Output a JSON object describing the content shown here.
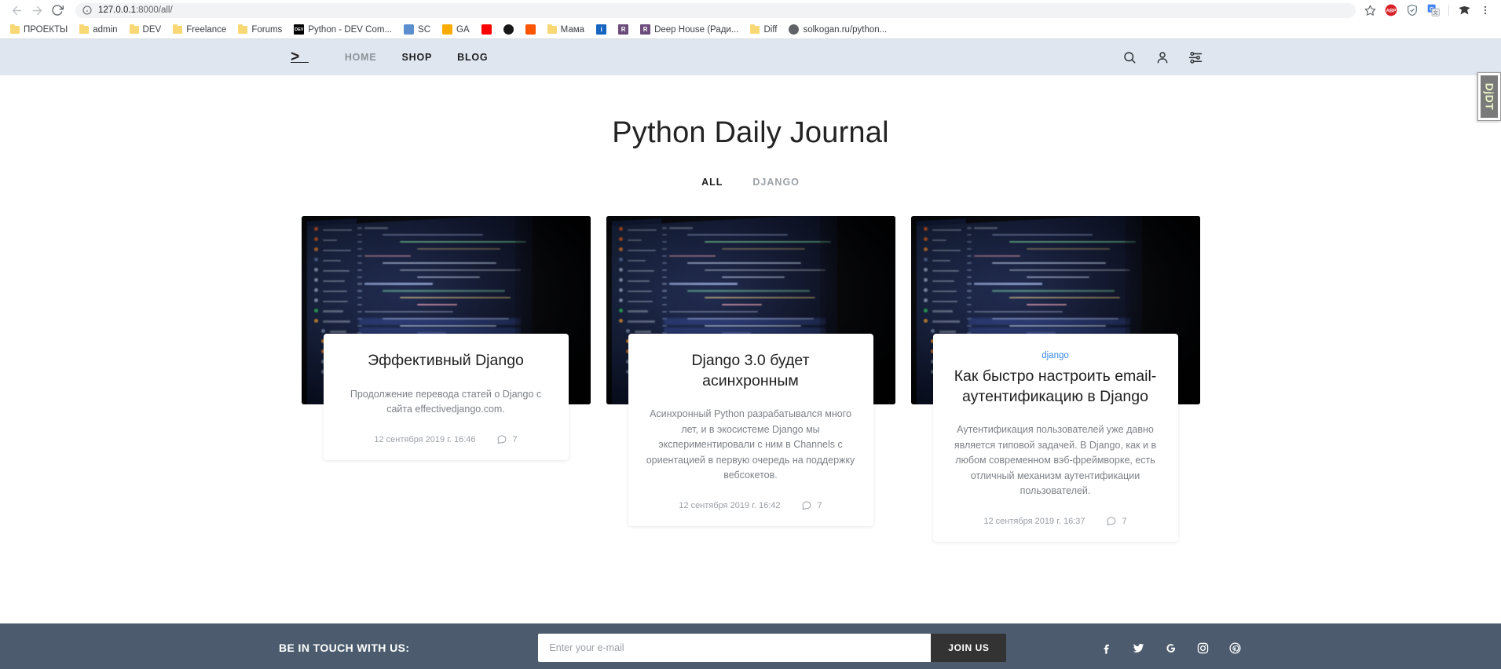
{
  "browser": {
    "back_label": "Back",
    "forward_label": "Forward",
    "reload_label": "Reload",
    "url_host": "127.0.0.1",
    "url_rest": ":8000/all/",
    "site_info_icon": "info-circle-icon",
    "bookmark_star_icon": "star-icon",
    "extensions": [
      {
        "name": "adblock-plus-extension",
        "label": "ABP",
        "color": "#d81f26"
      },
      {
        "name": "shield-extension",
        "label": "",
        "color": "#6b7b86"
      },
      {
        "name": "google-translate-extension",
        "label": "G",
        "color": "#4285f4"
      },
      {
        "name": "dark-reader-extension",
        "label": "",
        "color": "#3a3a3a"
      }
    ],
    "menu_icon": "three-dots-menu-icon",
    "bookmarks": [
      {
        "label": "ПРОЕКТЫ",
        "icon": "folder-icon",
        "type": "folder"
      },
      {
        "label": "admin",
        "icon": "folder-icon",
        "type": "folder"
      },
      {
        "label": "DEV",
        "icon": "folder-icon",
        "type": "folder"
      },
      {
        "label": "Freelance",
        "icon": "folder-icon",
        "type": "folder"
      },
      {
        "label": "Forums",
        "icon": "folder-icon",
        "type": "folder"
      },
      {
        "label": "Python - DEV Com...",
        "icon": "dev-to-favicon",
        "type": "site",
        "color": "#000000",
        "glyph": "DEV"
      },
      {
        "label": "SC",
        "icon": "scholar-favicon",
        "type": "site",
        "color": "#5b8fd0",
        "glyph": ""
      },
      {
        "label": "GA",
        "icon": "google-analytics-favicon",
        "type": "site",
        "color": "#f9ab00",
        "glyph": ""
      },
      {
        "label": "",
        "icon": "youtube-favicon",
        "type": "site",
        "color": "#ff0000",
        "glyph": ""
      },
      {
        "label": "",
        "icon": "github-favicon",
        "type": "site",
        "color": "#181717",
        "glyph": ""
      },
      {
        "label": "",
        "icon": "soundcloud-favicon",
        "type": "site",
        "color": "#ff5500",
        "glyph": ""
      },
      {
        "label": "Мама",
        "icon": "folder-icon",
        "type": "folder"
      },
      {
        "label": "",
        "icon": "info-favicon",
        "type": "site",
        "color": "#1565c0",
        "glyph": "i"
      },
      {
        "label": "",
        "icon": "radio-record-favicon",
        "type": "site",
        "color": "#6b4c7a",
        "glyph": "R"
      },
      {
        "label": "Deep House (Ради...",
        "icon": "radio-favicon",
        "type": "site",
        "color": "#6b4c7a",
        "glyph": "R"
      },
      {
        "label": "Diff",
        "icon": "folder-icon",
        "type": "folder"
      },
      {
        "label": "solkogan.ru/python...",
        "icon": "globe-favicon",
        "type": "site",
        "color": "#5f6368",
        "glyph": ""
      }
    ]
  },
  "site": {
    "brand_logo": ">_",
    "nav": [
      {
        "label": "HOME",
        "name": "nav-link-home",
        "muted": true
      },
      {
        "label": "SHOP",
        "name": "nav-link-shop",
        "muted": false
      },
      {
        "label": "BLOG",
        "name": "nav-link-blog",
        "muted": false
      }
    ],
    "nav_icons": [
      {
        "name": "search-icon"
      },
      {
        "name": "user-account-icon"
      },
      {
        "name": "settings-sliders-icon"
      }
    ],
    "title": "Python Daily Journal",
    "filters": [
      {
        "label": "ALL",
        "name": "filter-all",
        "active": true
      },
      {
        "label": "DJANGO",
        "name": "filter-django",
        "active": false
      }
    ],
    "cards": [
      {
        "tag": "",
        "title": "Эффективный Django",
        "text": "Продолжение перевода статей о Django с сайта effectivedjango.com.",
        "date": "12 сентября 2019 г. 16:46",
        "comments": "7"
      },
      {
        "tag": "",
        "title": "Django 3.0 будет асинхронным",
        "text": "Асинхронный Python разрабатывался много лет, и в экосистеме Django мы экспериментировали с ним в Channels с ориентацией в первую очередь на поддержку вебсокетов.",
        "date": "12 сентября 2019 г. 16:42",
        "comments": "7"
      },
      {
        "tag": "django",
        "title": "Как быстро настроить email-аутентификацию в Django",
        "text": "Аутентификация пользователей уже давно является типовой задачей. В Django, как и в любом современном вэб-фреймворке, есть отличный механизм аутентификации пользователей.",
        "date": "12 сентября 2019 г. 16:37",
        "comments": "7"
      }
    ],
    "footer": {
      "label": "BE IN TOUCH WITH US:",
      "email_placeholder": "Enter your e-mail",
      "email_value": "",
      "join_label": "JOIN US",
      "socials": [
        {
          "name": "facebook-icon"
        },
        {
          "name": "twitter-icon"
        },
        {
          "name": "google-icon"
        },
        {
          "name": "instagram-icon"
        },
        {
          "name": "pinterest-icon"
        }
      ]
    }
  },
  "debug_toolbar": {
    "label": "DjDT"
  },
  "colors": {
    "nav_bg": "#dfe6ef",
    "footer_bg": "#4c5c6e",
    "tag_link": "#3a87e8",
    "join_btn": "#333333"
  }
}
